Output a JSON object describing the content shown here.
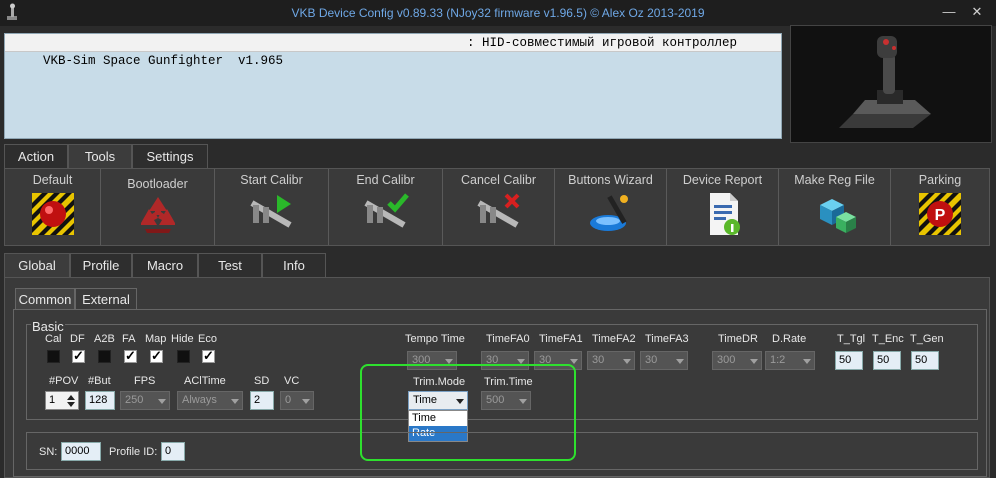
{
  "window": {
    "title": "VKB Device Config v0.89.33 (NJoy32 firmware v1.96.5) © Alex Oz 2013-2019",
    "minimize_glyph": "—",
    "close_glyph": "✕"
  },
  "device_list": {
    "rows": [
      {
        "name": "VKB-Sim Space Gunfighter  v1.965",
        "desc": ": HID-совместимый игровой контроллер"
      }
    ]
  },
  "top_tabs": [
    "Action",
    "Tools",
    "Settings"
  ],
  "active_top_tab": "Tools",
  "toolbar": {
    "items": [
      {
        "label": "Default",
        "icon": "hazard-red-button-icon"
      },
      {
        "label": "Bootloader",
        "icon": "recycle-icon"
      },
      {
        "label": "Start Calibr",
        "icon": "caliper-play-icon"
      },
      {
        "label": "End Calibr",
        "icon": "caliper-check-icon"
      },
      {
        "label": "Cancel Calibr",
        "icon": "caliper-cancel-icon"
      },
      {
        "label": "Buttons Wizard",
        "icon": "magic-wand-icon"
      },
      {
        "label": "Device Report",
        "icon": "document-info-icon"
      },
      {
        "label": "Make Reg File",
        "icon": "registry-cubes-icon"
      },
      {
        "label": "Parking",
        "icon": "parking-sign-icon"
      }
    ]
  },
  "mid_tabs": [
    "Global",
    "Profile",
    "Macro",
    "Test",
    "Info"
  ],
  "active_mid_tab": "Global",
  "sub_tabs": [
    "Common",
    "External"
  ],
  "active_sub_tab": "Common",
  "basic": {
    "title": "Basic",
    "flags": [
      {
        "label": "Cal",
        "checked": false
      },
      {
        "label": "DF",
        "checked": true
      },
      {
        "label": "A2B",
        "checked": false
      },
      {
        "label": "FA",
        "checked": true
      },
      {
        "label": "Map",
        "checked": true
      },
      {
        "label": "Hide",
        "checked": false
      },
      {
        "label": "Eco",
        "checked": true
      }
    ],
    "labels": {
      "pov": "#POV",
      "but": "#But",
      "fps": "FPS",
      "acltime": "AClTime",
      "sd": "SD",
      "vc": "VC",
      "tempo_time": "Tempo Time",
      "timefa0": "TimeFA0",
      "timefa1": "TimeFA1",
      "timefa2": "TimeFA2",
      "timefa3": "TimeFA3",
      "timedr": "TimeDR",
      "drate": "D.Rate",
      "t_tgl": "T_Tgl",
      "t_enc": "T_Enc",
      "t_gen": "T_Gen",
      "trim_mode": "Trim.Mode",
      "trim_time": "Trim.Time"
    },
    "values": {
      "pov": "1",
      "but": "128",
      "fps": "250",
      "acltime": "Always",
      "sd": "2",
      "vc": "0",
      "tempo_time": "300",
      "timefa0": "30",
      "timefa1": "30",
      "timefa2": "30",
      "timefa3": "30",
      "timedr": "300",
      "drate": "1:2",
      "t_tgl": "50",
      "t_enc": "50",
      "t_gen": "50",
      "trim_mode": "Time",
      "trim_time": "500"
    },
    "trim_mode_options": [
      "Time",
      "Rate"
    ],
    "trim_mode_highlighted": "Rate"
  },
  "identity": {
    "sn_label": "SN:",
    "sn_value": "0000",
    "profile_label": "Profile ID:",
    "profile_value": "0"
  },
  "colors": {
    "accent_title": "#6fa8e6",
    "highlight_outline": "#2ee02e",
    "dropdown_selection": "#2a78c8"
  }
}
